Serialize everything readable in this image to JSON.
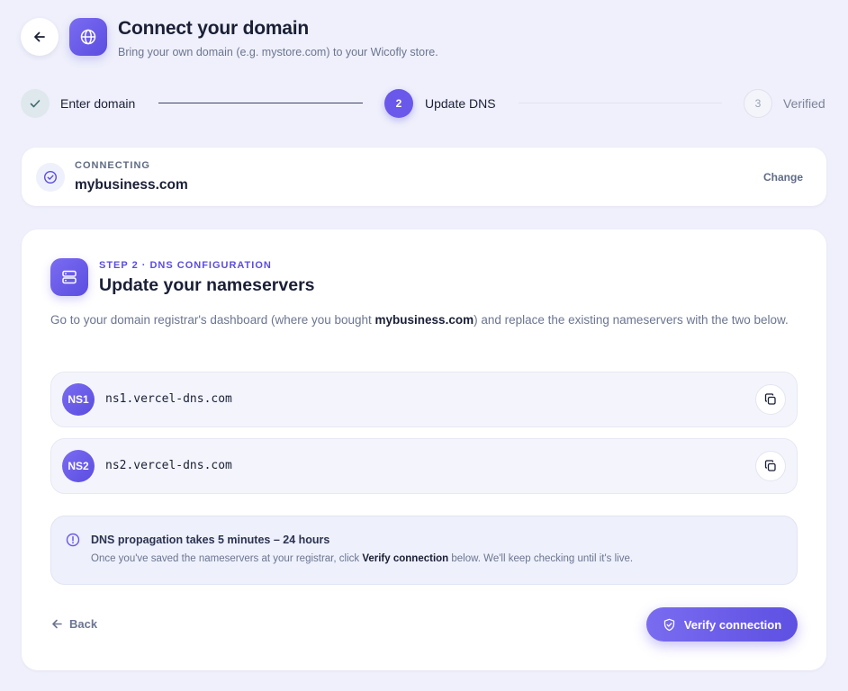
{
  "header": {
    "title": "Connect your domain",
    "subtitle": "Bring your own domain (e.g. mystore.com) to your Wicofly store."
  },
  "stepper": {
    "steps": [
      {
        "number": "1",
        "label": "Enter domain",
        "state": "done"
      },
      {
        "number": "2",
        "label": "Update DNS",
        "state": "active"
      },
      {
        "number": "3",
        "label": "Verified",
        "state": "pending"
      }
    ]
  },
  "connecting": {
    "eyebrow": "CONNECTING",
    "domain": "mybusiness.com",
    "change_label": "Change"
  },
  "dns": {
    "eyebrow": "STEP 2 · DNS CONFIGURATION",
    "title": "Update your nameservers",
    "desc_before": "Go to your domain registrar's dashboard (where you bought ",
    "desc_domain": "mybusiness.com",
    "desc_after": ") and replace the existing nameservers with the two below.",
    "nameservers": [
      {
        "badge": "NS1",
        "value": "ns1.vercel-dns.com"
      },
      {
        "badge": "NS2",
        "value": "ns2.vercel-dns.com"
      }
    ]
  },
  "info": {
    "title": "DNS propagation takes 5 minutes – 24 hours",
    "text_before": "Once you've saved the nameservers at your registrar, click ",
    "text_bold": "Verify connection",
    "text_after": " below. We'll keep checking until it's live."
  },
  "footer": {
    "back_label": "Back",
    "verify_label": "Verify connection"
  },
  "colors": {
    "accent": "#6a58ea",
    "background": "#eff0fb",
    "text_primary": "#1a1f36",
    "text_muted": "#6b7591"
  }
}
